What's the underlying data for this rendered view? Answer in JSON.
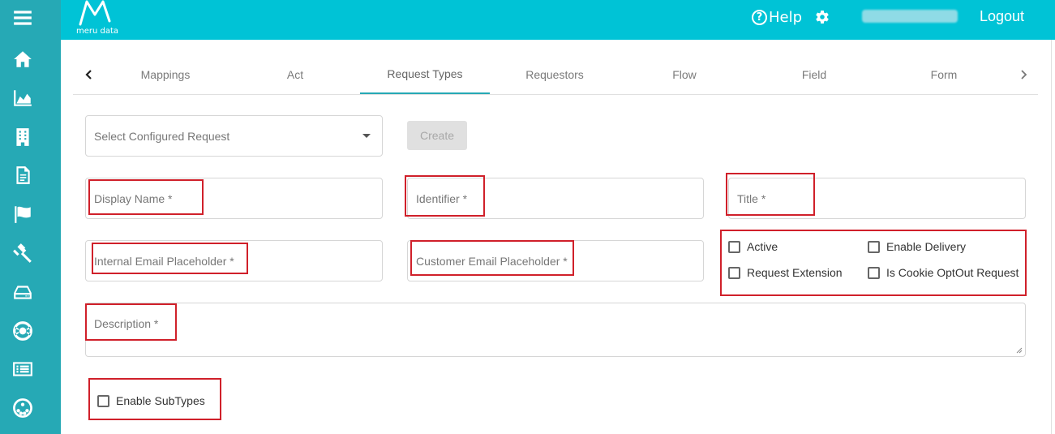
{
  "header": {
    "logo_text": "meru data",
    "help_label": "Help",
    "logout_label": "Logout"
  },
  "sidebar": {
    "items": [
      {
        "icon": "menu-icon"
      },
      {
        "icon": "home-icon"
      },
      {
        "icon": "area-chart-icon"
      },
      {
        "icon": "building-icon"
      },
      {
        "icon": "document-icon"
      },
      {
        "icon": "flag-icon"
      },
      {
        "icon": "gavel-icon"
      },
      {
        "icon": "inbox-tray-icon"
      },
      {
        "icon": "lifebuoy-icon"
      },
      {
        "icon": "list-card-icon"
      },
      {
        "icon": "network-circle-icon"
      }
    ]
  },
  "tabs": [
    {
      "label": "Mappings"
    },
    {
      "label": "Act"
    },
    {
      "label": "Request Types",
      "active": true
    },
    {
      "label": "Requestors"
    },
    {
      "label": "Flow"
    },
    {
      "label": "Field"
    },
    {
      "label": "Form"
    }
  ],
  "form": {
    "select_placeholder": "Select Configured Request",
    "create_label": "Create",
    "display_name": "Display Name *",
    "identifier": "Identifier *",
    "title": "Title *",
    "internal_email": "Internal Email Placeholder *",
    "customer_email": "Customer Email Placeholder *",
    "description": "Description *",
    "checkboxes": {
      "active": "Active",
      "enable_delivery": "Enable Delivery",
      "request_extension": "Request Extension",
      "cookie_optout": "Is Cookie OptOut Request",
      "enable_subtypes": "Enable SubTypes"
    }
  },
  "colors": {
    "sidebar": "#26a9b5",
    "header": "#00c3d6",
    "annotation": "#d0202a"
  }
}
